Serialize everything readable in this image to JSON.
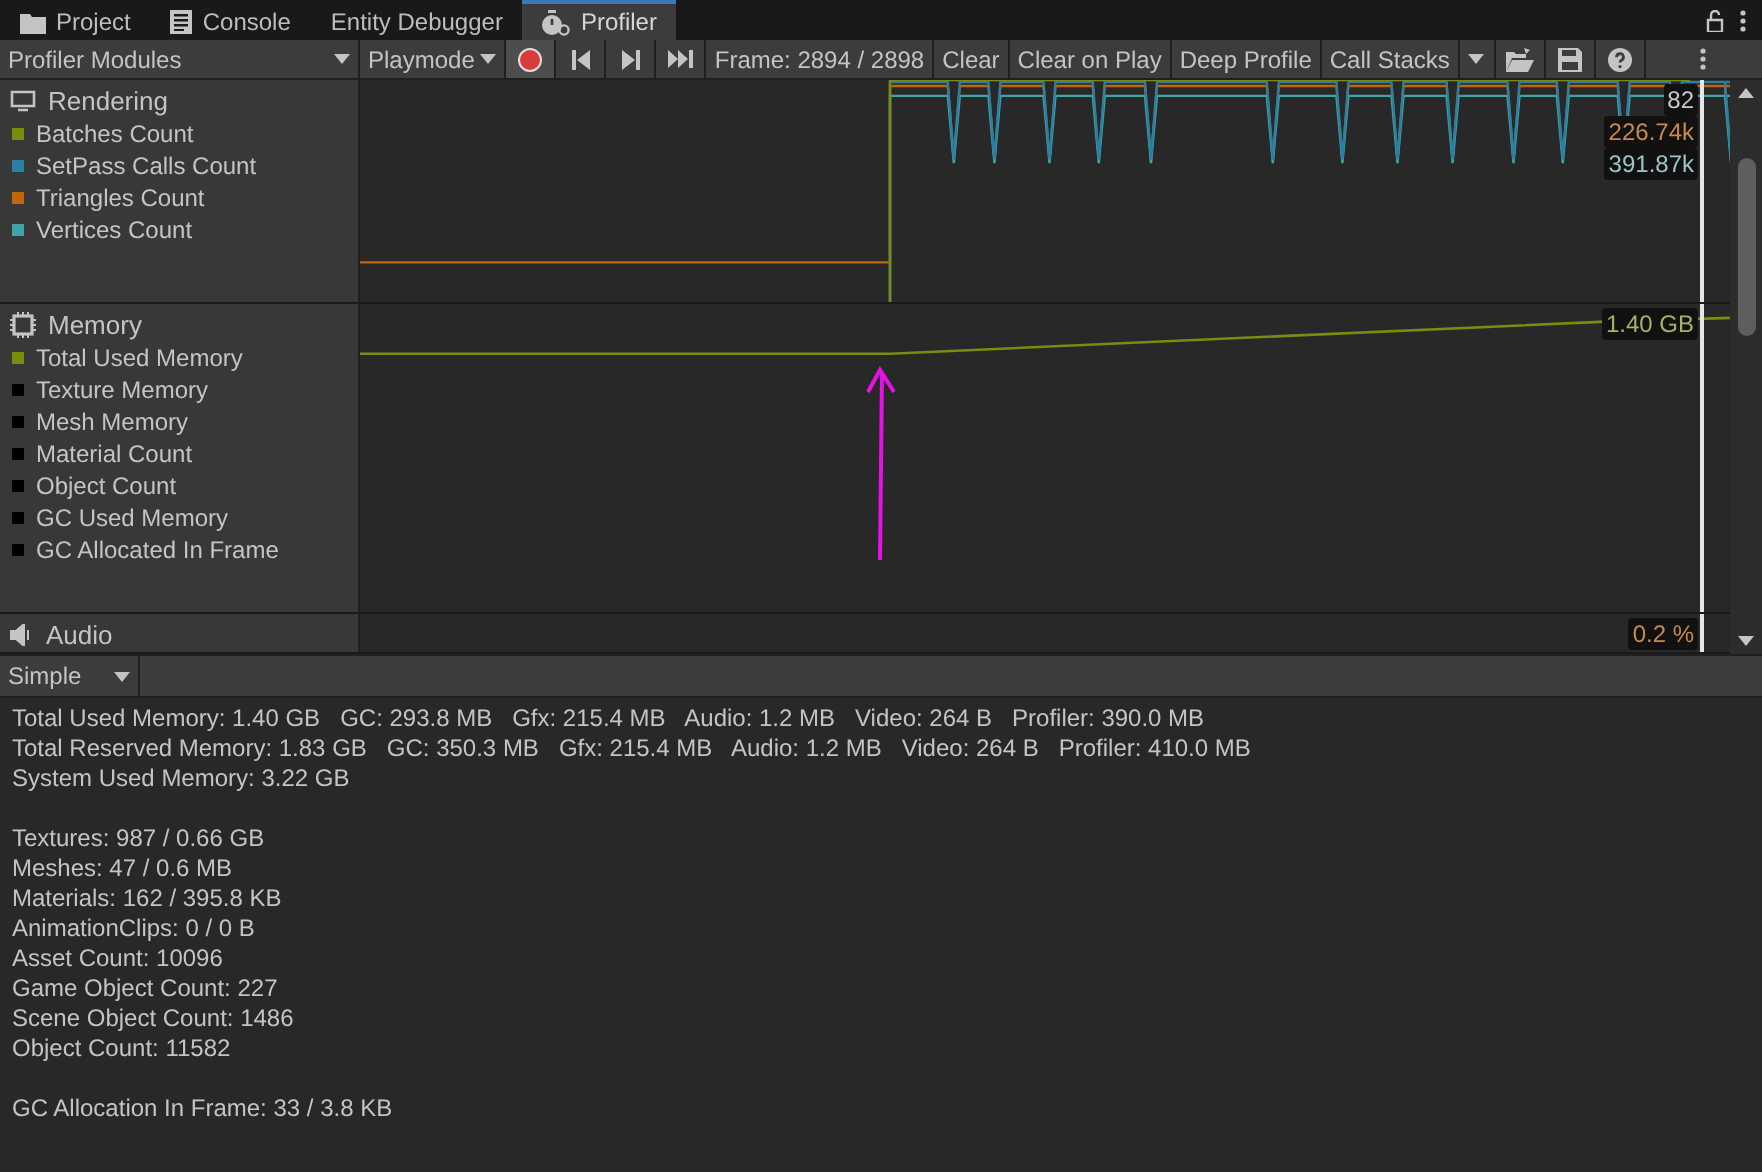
{
  "tabs": [
    {
      "label": "Project",
      "kind": "folder",
      "selected": false
    },
    {
      "label": "Console",
      "kind": "console",
      "selected": false
    },
    {
      "label": "Entity Debugger",
      "kind": "plain",
      "selected": false
    },
    {
      "label": "Profiler",
      "kind": "stopwatch",
      "selected": true
    }
  ],
  "toolbar": {
    "modules_dropdown": "Profiler Modules",
    "target_dropdown": "Playmode",
    "recording": true,
    "frame": "Frame: 2894 / 2898",
    "buttons": [
      "Clear",
      "Clear on Play",
      "Deep Profile"
    ],
    "call_stacks": "Call Stacks"
  },
  "modules": [
    {
      "title": "Rendering",
      "kind": "rendering",
      "legend": [
        {
          "label": "Batches Count",
          "color": "#7b8c10"
        },
        {
          "label": "SetPass Calls Count",
          "color": "#2a7fa3"
        },
        {
          "label": "Triangles Count",
          "color": "#c0660e"
        },
        {
          "label": "Vertices Count",
          "color": "#3fa3a8"
        }
      ],
      "readings": [
        "82",
        "226.74k",
        "391.87k"
      ]
    },
    {
      "title": "Memory",
      "kind": "memory",
      "legend": [
        {
          "label": "Total Used Memory",
          "color": "#7b8c10"
        },
        {
          "label": "Texture Memory",
          "color": "#000000"
        },
        {
          "label": "Mesh Memory",
          "color": "#000000"
        },
        {
          "label": "Material Count",
          "color": "#000000"
        },
        {
          "label": "Object Count",
          "color": "#000000"
        },
        {
          "label": "GC Used Memory",
          "color": "#000000"
        },
        {
          "label": "GC Allocated In Frame",
          "color": "#000000"
        }
      ],
      "readings": [
        "1.40 GB"
      ]
    },
    {
      "title": "Audio",
      "kind": "audio",
      "readings": [
        "0.2 %"
      ]
    }
  ],
  "details": {
    "view_dropdown": "Simple",
    "paragraphs": [
      [
        "Total Used Memory: 1.40 GB   GC: 293.8 MB   Gfx: 215.4 MB   Audio: 1.2 MB   Video: 264 B   Profiler: 390.0 MB",
        "Total Reserved Memory: 1.83 GB   GC: 350.3 MB   Gfx: 215.4 MB   Audio: 1.2 MB   Video: 264 B   Profiler: 410.0 MB",
        "System Used Memory: 3.22 GB"
      ],
      [
        "Textures: 987 / 0.66 GB",
        "Meshes: 47 / 0.6 MB",
        "Materials: 162 / 395.8 KB",
        "AnimationClips: 0 / 0 B",
        "Asset Count: 10096",
        "Game Object Count: 227",
        "Scene Object Count: 1486",
        "Object Count: 11582"
      ],
      [
        "GC Allocation In Frame: 33 / 3.8 KB"
      ]
    ]
  }
}
